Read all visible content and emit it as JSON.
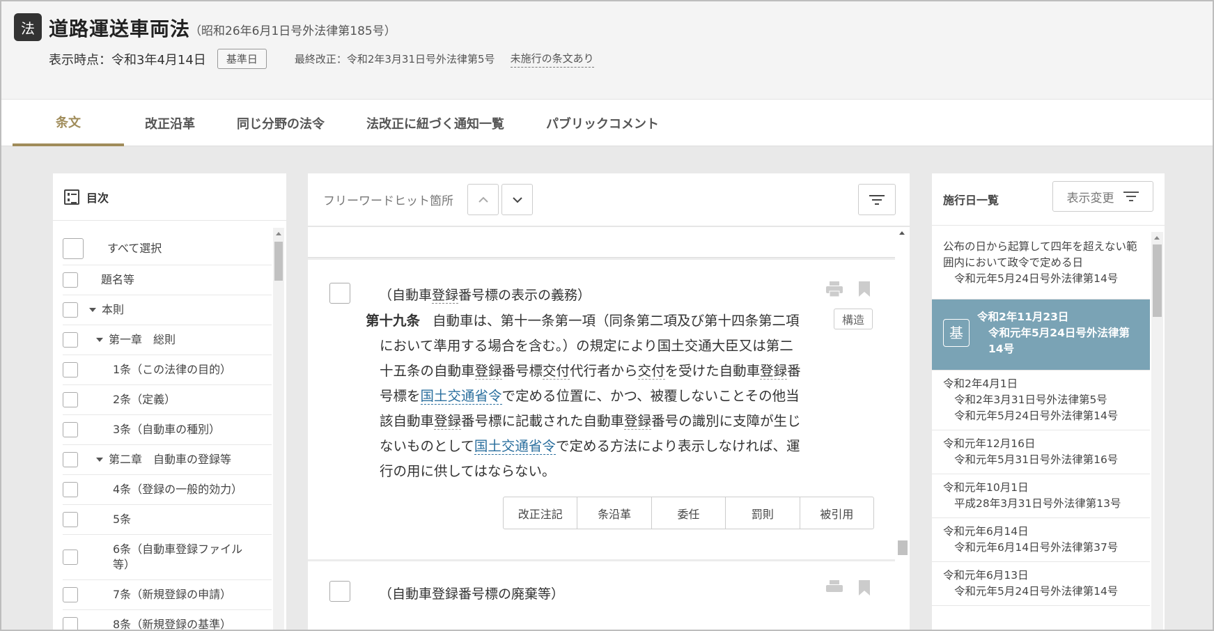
{
  "header": {
    "badge": "法",
    "title": "道路運送車両法",
    "law_number": "（昭和26年6月1日号外法律第185号）",
    "display_date": "表示時点：令和3年4月14日",
    "base_date_button": "基準日",
    "last_amendment": "最終改正：令和2年3月31日号外法律第5号",
    "unenforced": "未施行の条文あり"
  },
  "tabs": [
    {
      "label": "条文",
      "active": true
    },
    {
      "label": "改正沿革",
      "active": false
    },
    {
      "label": "同じ分野の法令",
      "active": false
    },
    {
      "label": "法改正に紐づく通知一覧",
      "active": false
    },
    {
      "label": "パブリックコメント",
      "active": false
    }
  ],
  "toc": {
    "title": "目次",
    "items": [
      {
        "label": "すべて選択"
      },
      {
        "label": "題名等"
      },
      {
        "label": "本則"
      },
      {
        "label": "第一章　総則"
      },
      {
        "label": "1条（この法律の目的）"
      },
      {
        "label": "2条（定義）"
      },
      {
        "label": "3条（自動車の種別）"
      },
      {
        "label": "第二章　自動車の登録等"
      },
      {
        "label": "4条（登録の一般的効力）"
      },
      {
        "label": "5条"
      },
      {
        "label": "6条（自動車登録ファイル等）"
      },
      {
        "label": "7条（新規登録の申請）"
      },
      {
        "label": "8条（新規登録の基準）"
      }
    ]
  },
  "main": {
    "search_label": "フリーワードヒット箇所",
    "article": {
      "caption_open": "（自動車",
      "caption_u": "登録",
      "caption_close": "番号標の表示の義務）",
      "number": "第十九条",
      "lines": [
        "自動車は、第十一条第一項（同条第二項及び第十四条第二項",
        "において準用する場合を含む。）の規定により国土交通大臣又は第二"
      ],
      "line3_a": "十五条の自動車",
      "line3_u1": "登録",
      "line3_b": "番号標",
      "line3_u2": "交付",
      "line3_c": "代行者から",
      "line3_u3": "交付",
      "line3_d": "を受けた自動車",
      "line3_u4": "登録",
      "line3_e": "番",
      "line4_a": "号標を",
      "line4_link": "国土交通省令",
      "line4_b": "で定める位置に、かつ、被覆しないことその他当",
      "line5_a": "該自動車",
      "line5_u1": "登録",
      "line5_b": "番号標に記載された自動車",
      "line5_u2": "登録",
      "line5_c": "番号の識別に支障が生じ",
      "line6_a": "ないものとして",
      "line6_link": "国土交通省令",
      "line6_b": "で定める方法により表示しなければ、運",
      "line7": "行の用に供してはならない。",
      "structure_button": "構造",
      "actions": [
        "改正注記",
        "条沿革",
        "委任",
        "罰則",
        "被引用"
      ]
    },
    "next_article_caption": "（自動車登録番号標の廃棄等）"
  },
  "enforcement": {
    "title": "施行日一覧",
    "view_button": "表示変更",
    "items": [
      {
        "head": "公布の日から起算して四年を超えない範囲内において政令で定める日",
        "sub": [
          "令和元年5月24日号外法律第14号"
        ]
      },
      {
        "head": "令和2年11月23日",
        "sub": [
          "令和元年5月24日号外法律第14号"
        ],
        "selected": true,
        "mark": "基"
      },
      {
        "head": "令和2年4月1日",
        "sub": [
          "令和2年3月31日号外法律第5号",
          "令和元年5月24日号外法律第14号"
        ]
      },
      {
        "head": "令和元年12月16日",
        "sub": [
          "令和元年5月31日号外法律第16号"
        ]
      },
      {
        "head": "令和元年10月1日",
        "sub": [
          "平成28年3月31日号外法律第13号"
        ]
      },
      {
        "head": "令和元年6月14日",
        "sub": [
          "令和元年6月14日号外法律第37号"
        ]
      },
      {
        "head": "令和元年6月13日",
        "sub": [
          "令和元年5月24日号外法律第14号"
        ]
      }
    ]
  }
}
